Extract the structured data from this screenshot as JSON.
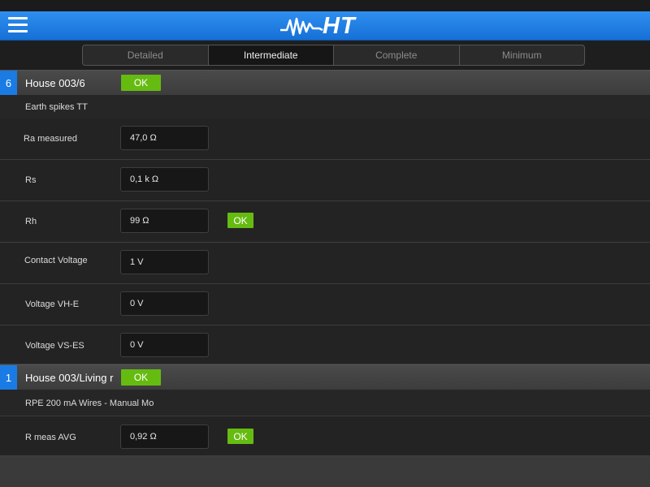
{
  "app": {
    "logo_text": "HT",
    "logo_icon": "waveform-icon",
    "menu_icon": "hamburger-icon",
    "accent": "#1a7be4",
    "ok_color": "#66bb11"
  },
  "tabs": [
    {
      "label": "Detailed",
      "active": false
    },
    {
      "label": "Intermediate",
      "active": true
    },
    {
      "label": "Complete",
      "active": false
    },
    {
      "label": "Minimum",
      "active": false
    }
  ],
  "sections": [
    {
      "number": "6",
      "title": "House 003/6",
      "status": "OK",
      "subtitle": "Earth spikes TT",
      "rows": [
        {
          "label": "Ra measured",
          "value": "47,0 Ω",
          "status": ""
        },
        {
          "label": "Rs",
          "value": "0,1 k Ω",
          "status": ""
        },
        {
          "label": "Rh",
          "value": "99 Ω",
          "status": "OK"
        },
        {
          "label": "Contact Voltage",
          "value": "1 V",
          "status": ""
        },
        {
          "label": "Voltage VH-E",
          "value": "0 V",
          "status": ""
        },
        {
          "label": "Voltage VS-ES",
          "value": "0 V",
          "status": ""
        }
      ]
    },
    {
      "number": "1",
      "title": "House 003/Living r",
      "status": "OK",
      "subtitle": "RPE 200 mA Wires - Manual Mo",
      "rows": [
        {
          "label": "R meas AVG",
          "value": "0,92 Ω",
          "status": "OK"
        }
      ]
    }
  ]
}
